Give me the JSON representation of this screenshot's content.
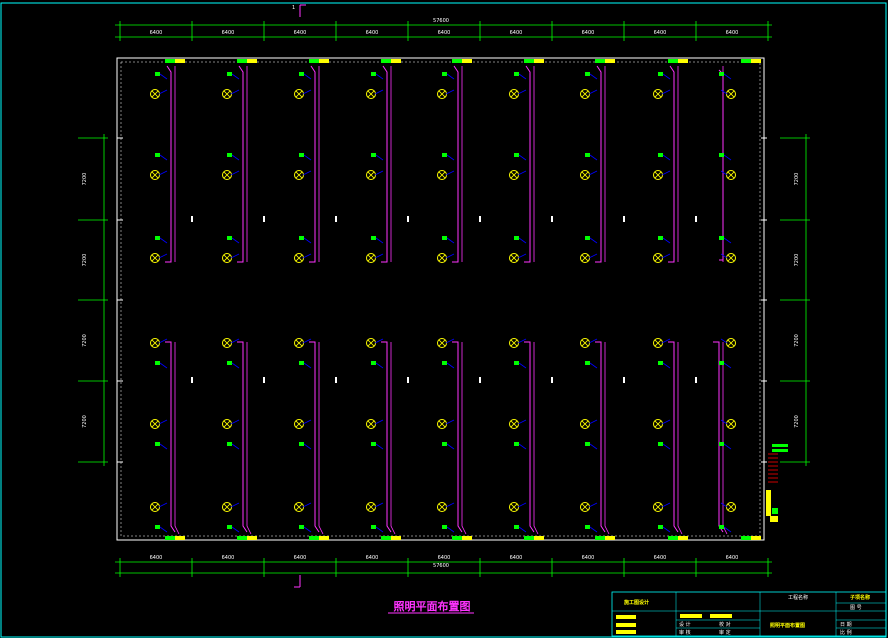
{
  "drawing": {
    "title": "照明平面布置图",
    "section_mark_top": "1",
    "overall_dimension": "57600",
    "bay_dimensions": [
      "6400",
      "6400",
      "6400",
      "6400",
      "6400",
      "6400",
      "6400",
      "6400",
      "6400"
    ],
    "left_dimensions": [
      "7200",
      "7200",
      "7200",
      "7200"
    ],
    "right_dimensions": [
      "7200",
      "7200",
      "7200",
      "7200"
    ],
    "colors": {
      "background": "#000000",
      "border": "#00ffff",
      "dimension": "#00ff00",
      "wall": "#ffffff",
      "wiring": "#ff33ff",
      "lamp": "#ffff00",
      "device": "#00ff00",
      "accent": "#0000ff",
      "title": "#ff33ff"
    }
  },
  "title_block": {
    "project_label": "施工图设计",
    "client_label": "工程名称",
    "drawing_name": "照明平面布置图",
    "sheet_label": "子项名称",
    "sheet_sub": "图 号",
    "sign_labels": [
      "设 计",
      "校 对",
      "审 核",
      "审 定"
    ],
    "date_labels": [
      "日 期",
      "比 例"
    ]
  }
}
